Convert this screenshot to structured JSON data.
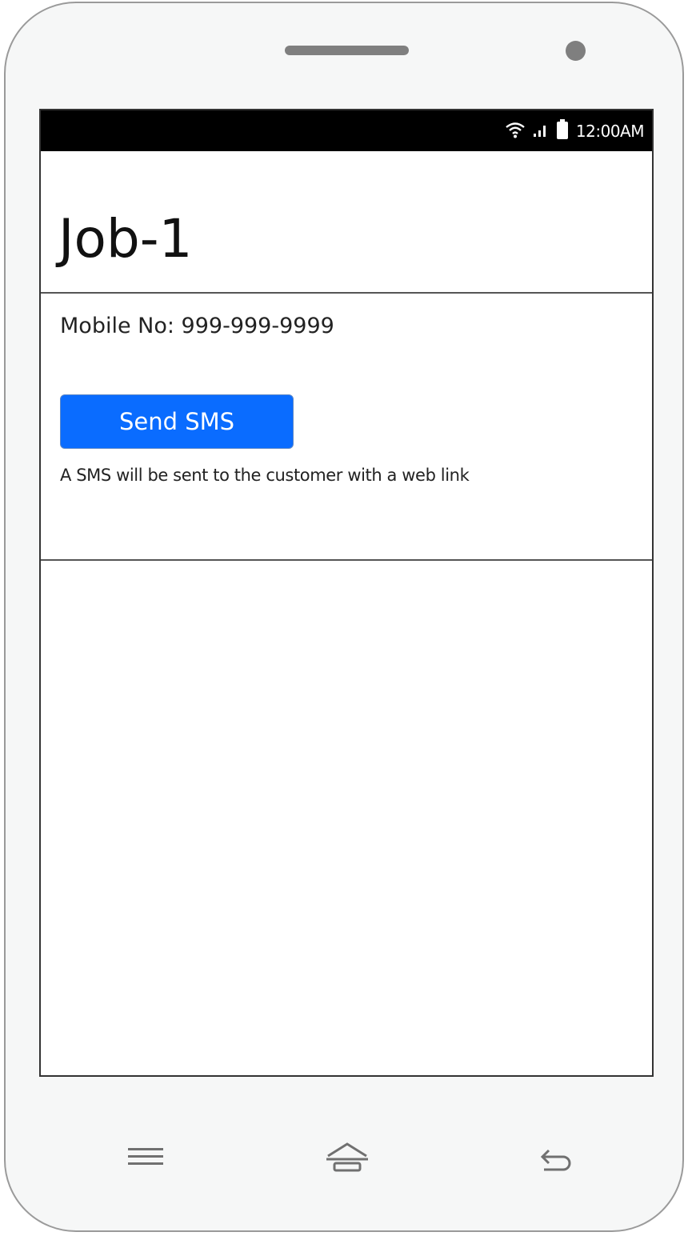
{
  "status_bar": {
    "time": "12:00AM",
    "icons": [
      "wifi-icon",
      "signal-icon",
      "battery-icon"
    ]
  },
  "job": {
    "title": "Job-1",
    "mobile": "Mobile No: 999-999-9999"
  },
  "actions": {
    "send_sms_label": "Send SMS",
    "send_sms_hint": "A SMS will be sent to the customer with a web link"
  },
  "nav_bar": {
    "buttons": [
      "menu-icon",
      "home-icon",
      "back-icon"
    ]
  },
  "colors": {
    "accent": "#0a6cff",
    "status_bar": "#000000",
    "device_frame": "#f6f7f7"
  }
}
